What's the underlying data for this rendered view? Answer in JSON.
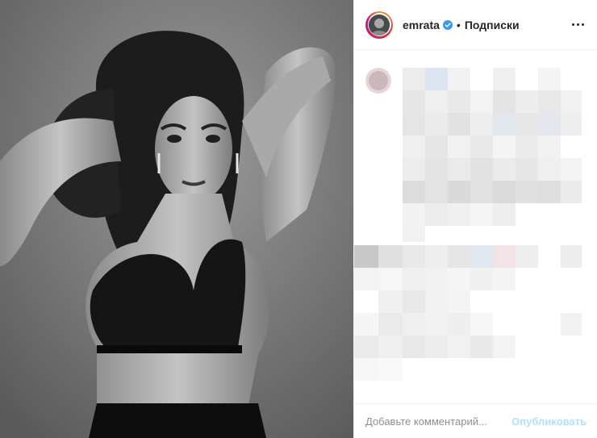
{
  "post": {
    "username": "emrata",
    "separator": "•",
    "follow_label": "Подписки"
  },
  "comment": {
    "placeholder": "Добавьте комментарий...",
    "publish_label": "Опубликовать"
  },
  "colors": {
    "accent": "#0095f6",
    "publish_disabled": "#b2dffc",
    "verified": "#3897f0"
  },
  "icons": [
    "verified-badge-icon",
    "more-options-icon"
  ]
}
